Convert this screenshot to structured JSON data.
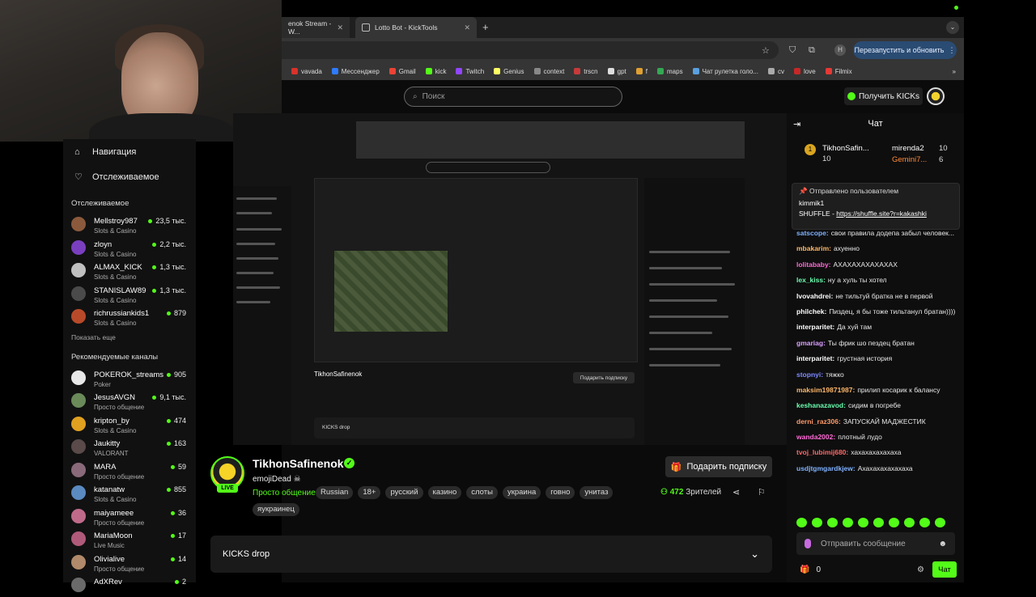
{
  "browser": {
    "tabs": [
      {
        "label": "enok Stream - W..."
      },
      {
        "label": "Lotto Bot - KickTools"
      }
    ],
    "new_tab": "+",
    "relaunch_label": "Перезапустить и обновить",
    "profile_initial": "Н",
    "bookmarks": [
      {
        "label": "vavada",
        "color": "#d9322a"
      },
      {
        "label": "Мессенджер",
        "color": "#2f7bff"
      },
      {
        "label": "Gmail",
        "color": "#ea4335"
      },
      {
        "label": "kick",
        "color": "#53fc18"
      },
      {
        "label": "Twitch",
        "color": "#9146ff"
      },
      {
        "label": "Genius",
        "color": "#ffff64"
      },
      {
        "label": "context",
        "color": "#888888"
      },
      {
        "label": "trscn",
        "color": "#c83a3a"
      },
      {
        "label": "gpt",
        "color": "#dddddd"
      },
      {
        "label": "f",
        "color": "#e0a030"
      },
      {
        "label": "maps",
        "color": "#34a853"
      },
      {
        "label": "Чат рулетка голо...",
        "color": "#5aa0e0"
      },
      {
        "label": "cv",
        "color": "#aaaaaa"
      },
      {
        "label": "love",
        "color": "#c62828"
      },
      {
        "label": "Filmix",
        "color": "#e53935"
      }
    ]
  },
  "kick": {
    "search_placeholder": "Поиск",
    "get_kicks": "Получить KICKs"
  },
  "sidebar": {
    "nav": [
      {
        "label": "Навигация",
        "icon": "home-icon"
      },
      {
        "label": "Отслеживаемое",
        "icon": "heart-icon"
      }
    ],
    "following_title": "Отслеживаемое",
    "following": [
      {
        "name": "Mellstroy987",
        "category": "Slots & Casino",
        "viewers": "23,5 тыс.",
        "color": "#8b5a3c"
      },
      {
        "name": "zloyn",
        "category": "Slots & Casino",
        "viewers": "2,2 тыс.",
        "color": "#7a3fbf"
      },
      {
        "name": "ALMAX_KICK",
        "category": "Slots & Casino",
        "viewers": "1,3 тыс.",
        "color": "#c0c0c0"
      },
      {
        "name": "STANISLAW89",
        "category": "Slots & Casino",
        "viewers": "1,3 тыс.",
        "color": "#4a4a4a"
      },
      {
        "name": "richrussiankids1",
        "category": "Slots & Casino",
        "viewers": "879",
        "color": "#b84a2a"
      }
    ],
    "show_more": "Показать еще",
    "recommended_title": "Рекомендуемые каналы",
    "recommended": [
      {
        "name": "POKEROK_streams",
        "category": "Poker",
        "viewers": "905",
        "color": "#e8e8e8"
      },
      {
        "name": "JesusAVGN",
        "category": "Просто общение",
        "viewers": "9,1 тыс.",
        "color": "#6a8a5a"
      },
      {
        "name": "kripton_by",
        "category": "Slots & Casino",
        "viewers": "474",
        "color": "#e0a020"
      },
      {
        "name": "Jaukitty",
        "category": "VALORANT",
        "viewers": "163",
        "color": "#5a4a4a"
      },
      {
        "name": "MARA",
        "category": "Просто общение",
        "viewers": "59",
        "color": "#8a6a7a"
      },
      {
        "name": "katanatw",
        "category": "Slots & Casino",
        "viewers": "855",
        "color": "#5a8ac0"
      },
      {
        "name": "maiyameee",
        "category": "Просто общение",
        "viewers": "36",
        "color": "#c06a8a"
      },
      {
        "name": "MariaMoon",
        "category": "Live Music",
        "viewers": "17",
        "color": "#b05a7a"
      },
      {
        "name": "Olivialive",
        "category": "Просто общение",
        "viewers": "14",
        "color": "#b08a6a"
      },
      {
        "name": "AdXRev",
        "category": "",
        "viewers": "2",
        "color": "#6a6a6a"
      }
    ]
  },
  "nested_preview": {
    "streamer": "TikhonSafinenok",
    "gift": "Подарить подписку",
    "kicks_drop": "KICKS drop"
  },
  "stream": {
    "live_badge": "LIVE",
    "streamer_name": "TikhonSafinenok",
    "title": "emojiDead ☠",
    "category": "Просто общение",
    "tags": [
      "Russian",
      "18+",
      "русский",
      "казино",
      "слоты",
      "украина",
      "говно",
      "унитаз"
    ],
    "extra_tag": "яукраинец",
    "gift_sub": "Подарить подписку",
    "viewers_count": "472",
    "viewers_label": "Зрителей",
    "kicks_drop": "KICKS drop"
  },
  "chat": {
    "title": "Чат",
    "leaders": [
      {
        "rank": "1",
        "name": "TikhonSafin...",
        "count": "10"
      },
      {
        "name": "mirenda2",
        "count": "10"
      },
      {
        "name": "Gemini7...",
        "count": "6"
      }
    ],
    "pinned": {
      "title": "Отправлено пользователем",
      "user": "kimmik1",
      "text": "SHUFFLE - ",
      "link": "https://shuffle.site?r=kakashki"
    },
    "messages": [
      {
        "user": "satscope:",
        "text": "свои правила додепа забыл человек...",
        "color": "#7fb2ff"
      },
      {
        "user": "mbakarim:",
        "text": "ахуенно",
        "color": "#ffb86a"
      },
      {
        "user": "lolitababy:",
        "text": "АХАХАХАХАХАХАХ",
        "color": "#ff6ad5"
      },
      {
        "user": "lex_kiss:",
        "text": "ну а хуль ты хотел",
        "color": "#6affb0"
      },
      {
        "user": "lvovahdrei:",
        "text": "не тильтуй братка не в первой",
        "color": "#ffffff"
      },
      {
        "user": "philchek:",
        "text": "Пиздец, я бы тоже тильтанул братан))))",
        "color": "#ffffff"
      },
      {
        "user": "interparitet:",
        "text": "Да хуй там",
        "color": "#ffffff"
      },
      {
        "user": "gmariag:",
        "text": "Ты фрик шо пездец братан",
        "color": "#d9a0ff"
      },
      {
        "user": "interparitet:",
        "text": "грустная история",
        "color": "#ffffff"
      },
      {
        "user": "stopnyi:",
        "text": "тяжко",
        "color": "#7f8aff"
      },
      {
        "user": "maksim19871987:",
        "text": "прилип косарик к балансу",
        "color": "#ffb86a"
      },
      {
        "user": "keshanazavod:",
        "text": "сидим в погребе",
        "color": "#6affb0"
      },
      {
        "user": "derni_raz306:",
        "text": "ЗАПУСКАЙ МАДЖЕСТИК",
        "color": "#ff9a6a"
      },
      {
        "user": "wanda2002:",
        "text": "плотный лудо",
        "color": "#ff6ad5"
      },
      {
        "user": "tvoj_lubimij680:",
        "text": "хахахахахахаха",
        "color": "#ff6a6a"
      },
      {
        "user": "usdjtgmgardkjew:",
        "text": "Ахахахахахахаха",
        "color": "#7fb2ff"
      }
    ],
    "input_placeholder": "Отправить сообщение",
    "kicks_count": "0",
    "send_label": "Чат"
  }
}
